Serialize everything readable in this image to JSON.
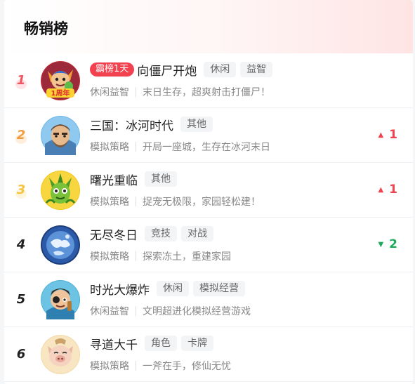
{
  "header": {
    "title": "畅销榜"
  },
  "rows": [
    {
      "rank": "1",
      "badge": "霸榜1天",
      "name": "向僵尸开炮",
      "tags": [
        "休闲",
        "益智"
      ],
      "category": "休闲益智",
      "desc": "末日生存，超爽射击打僵尸！",
      "change": "",
      "direction": "",
      "avatar_note": "1周年"
    },
    {
      "rank": "2",
      "badge": "",
      "name": "三国：冰河时代",
      "tags": [
        "其他"
      ],
      "category": "模拟策略",
      "desc": "开局一座城，生存在冰河末日",
      "change": "1",
      "direction": "up"
    },
    {
      "rank": "3",
      "badge": "",
      "name": "曙光重临",
      "tags": [
        "其他"
      ],
      "category": "模拟策略",
      "desc": "捉宠无极限，家园轻松建！",
      "change": "1",
      "direction": "up"
    },
    {
      "rank": "4",
      "badge": "",
      "name": "无尽冬日",
      "tags": [
        "竞技",
        "对战"
      ],
      "category": "模拟策略",
      "desc": "探索冻土，重建家园",
      "change": "2",
      "direction": "down"
    },
    {
      "rank": "5",
      "badge": "",
      "name": "时光大爆炸",
      "tags": [
        "休闲",
        "模拟经营"
      ],
      "category": "休闲益智",
      "desc": "文明超进化模拟经营游戏",
      "change": "",
      "direction": ""
    },
    {
      "rank": "6",
      "badge": "",
      "name": "寻道大千",
      "tags": [
        "角色",
        "卡牌"
      ],
      "category": "模拟策略",
      "desc": "一斧在手，修仙无忧",
      "change": "",
      "direction": ""
    }
  ],
  "colors": {
    "up": "#f2414f",
    "down": "#1aab5c",
    "badge": "#f2414f"
  }
}
